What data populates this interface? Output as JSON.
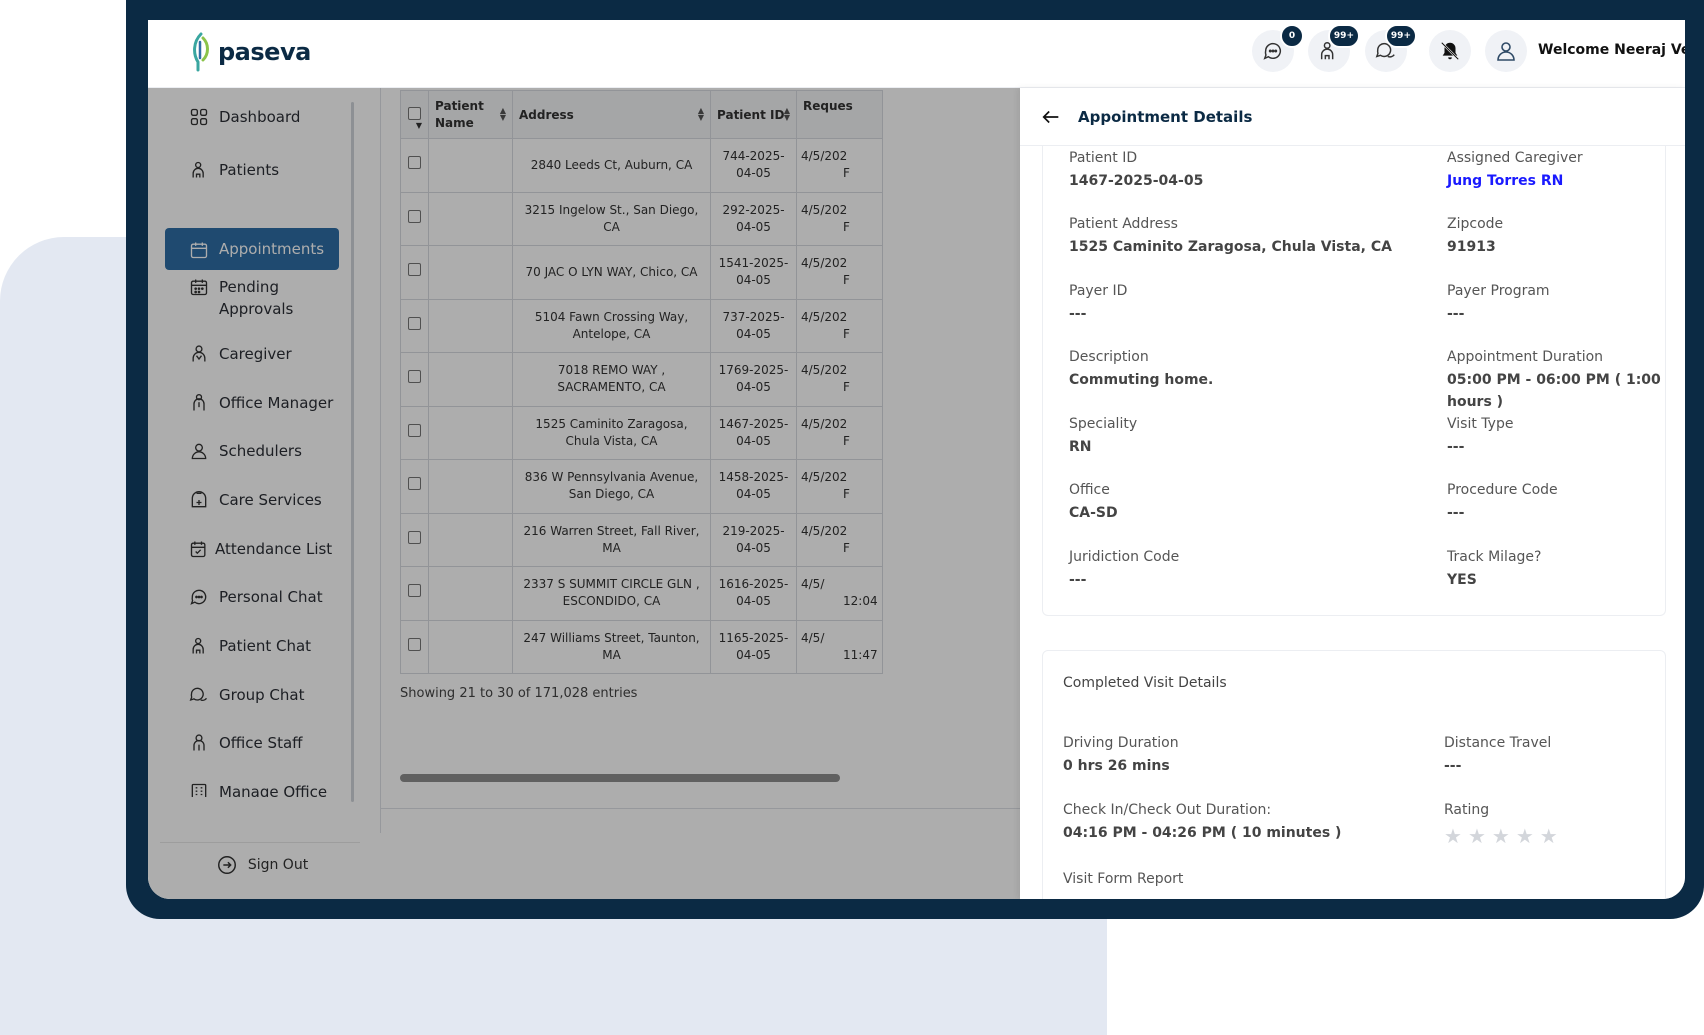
{
  "app": {
    "brand": "paseva"
  },
  "header": {
    "chat_badge": "0",
    "patient_badge": "99+",
    "group_badge": "99+",
    "welcome": "Welcome Neeraj Ven"
  },
  "sidebar": {
    "items": [
      {
        "label": "Dashboard",
        "icon": "grid-icon"
      },
      {
        "label": "Patients",
        "icon": "patient-icon"
      },
      {
        "label": "Appointments",
        "icon": "calendar-icon"
      },
      {
        "label": "Pending Approvals",
        "icon": "calendar-clock-icon"
      },
      {
        "label": "Caregiver",
        "icon": "caregiver-icon"
      },
      {
        "label": "Office Manager",
        "icon": "manager-icon"
      },
      {
        "label": "Schedulers",
        "icon": "user-icon"
      },
      {
        "label": "Care Services",
        "icon": "care-bag-icon"
      },
      {
        "label": "Attendance List",
        "icon": "attendance-icon"
      },
      {
        "label": "Personal Chat",
        "icon": "chat-icon"
      },
      {
        "label": "Patient Chat",
        "icon": "patient-chat-icon"
      },
      {
        "label": "Group Chat",
        "icon": "group-chat-icon"
      },
      {
        "label": "Office Staff",
        "icon": "staff-icon"
      },
      {
        "label": "Manage Office",
        "icon": "building-icon"
      }
    ],
    "signout": "Sign Out"
  },
  "table": {
    "headers": [
      "Patient Name",
      "Address",
      "Patient ID",
      "Reques"
    ],
    "rows": [
      {
        "address": "2840 Leeds Ct, Auburn, CA",
        "pid": "744-2025-04-05",
        "req": "4/5/202",
        "req2": "F"
      },
      {
        "address": "3215 Ingelow St., San Diego, CA",
        "pid": "292-2025-04-05",
        "req": "4/5/202",
        "req2": "F"
      },
      {
        "address": "70 JAC O LYN WAY, Chico, CA",
        "pid": "1541-2025-04-05",
        "req": "4/5/202",
        "req2": "F"
      },
      {
        "address": "5104 Fawn Crossing Way, Antelope, CA",
        "pid": "737-2025-04-05",
        "req": "4/5/202",
        "req2": "F"
      },
      {
        "address": "7018 REMO WAY , SACRAMENTO, CA",
        "pid": "1769-2025-04-05",
        "req": "4/5/202",
        "req2": "F"
      },
      {
        "address": "1525 Caminito Zaragosa, Chula Vista, CA",
        "pid": "1467-2025-04-05",
        "req": "4/5/202",
        "req2": "F"
      },
      {
        "address": "836 W Pennsylvania Avenue, San Diego, CA",
        "pid": "1458-2025-04-05",
        "req": "4/5/202",
        "req2": "F"
      },
      {
        "address": "216 Warren Street, Fall River, MA",
        "pid": "219-2025-04-05",
        "req": "4/5/202",
        "req2": "F"
      },
      {
        "address": "2337 S SUMMIT CIRCLE GLN , ESCONDIDO, CA",
        "pid": "1616-2025-04-05",
        "req": "4/5/",
        "req2": "12:04"
      },
      {
        "address": "247 Williams Street, Taunton, MA",
        "pid": "1165-2025-04-05",
        "req": "4/5/",
        "req2": "11:47"
      }
    ],
    "showing": "Showing 21 to 30 of 171,028 entries"
  },
  "panel": {
    "title": "Appointment Details",
    "fields": {
      "patient_id_label": "Patient ID",
      "patient_id": "1467-2025-04-05",
      "caregiver_label": "Assigned Caregiver",
      "caregiver": "Jung Torres RN",
      "address_label": "Patient Address",
      "address": "1525 Caminito Zaragosa, Chula Vista, CA",
      "zip_label": "Zipcode",
      "zip": "91913",
      "payer_id_label": "Payer ID",
      "payer_id": "---",
      "payer_program_label": "Payer Program",
      "payer_program": "---",
      "description_label": "Description",
      "description": "Commuting home.",
      "duration_label": "Appointment Duration",
      "duration": "05:00 PM - 06:00 PM ( 1:00 hours )",
      "speciality_label": "Speciality",
      "speciality": "RN",
      "visit_type_label": "Visit Type",
      "visit_type": "---",
      "office_label": "Office",
      "office": "CA-SD",
      "procedure_label": "Procedure Code",
      "procedure": "---",
      "juridiction_label": "Juridiction Code",
      "juridiction": "---",
      "milage_label": "Track Milage?",
      "milage": "YES"
    },
    "completed": {
      "title": "Completed Visit Details",
      "driving_label": "Driving Duration",
      "driving": "0 hrs 26 mins",
      "distance_label": "Distance Travel",
      "distance": "---",
      "checkin_label": "Check In/Check Out Duration:",
      "checkin": "04:16 PM - 04:26 PM ( 10 minutes )",
      "rating_label": "Rating",
      "rating": 0,
      "rating_max": 5,
      "form_label": "Visit Form Report"
    }
  }
}
